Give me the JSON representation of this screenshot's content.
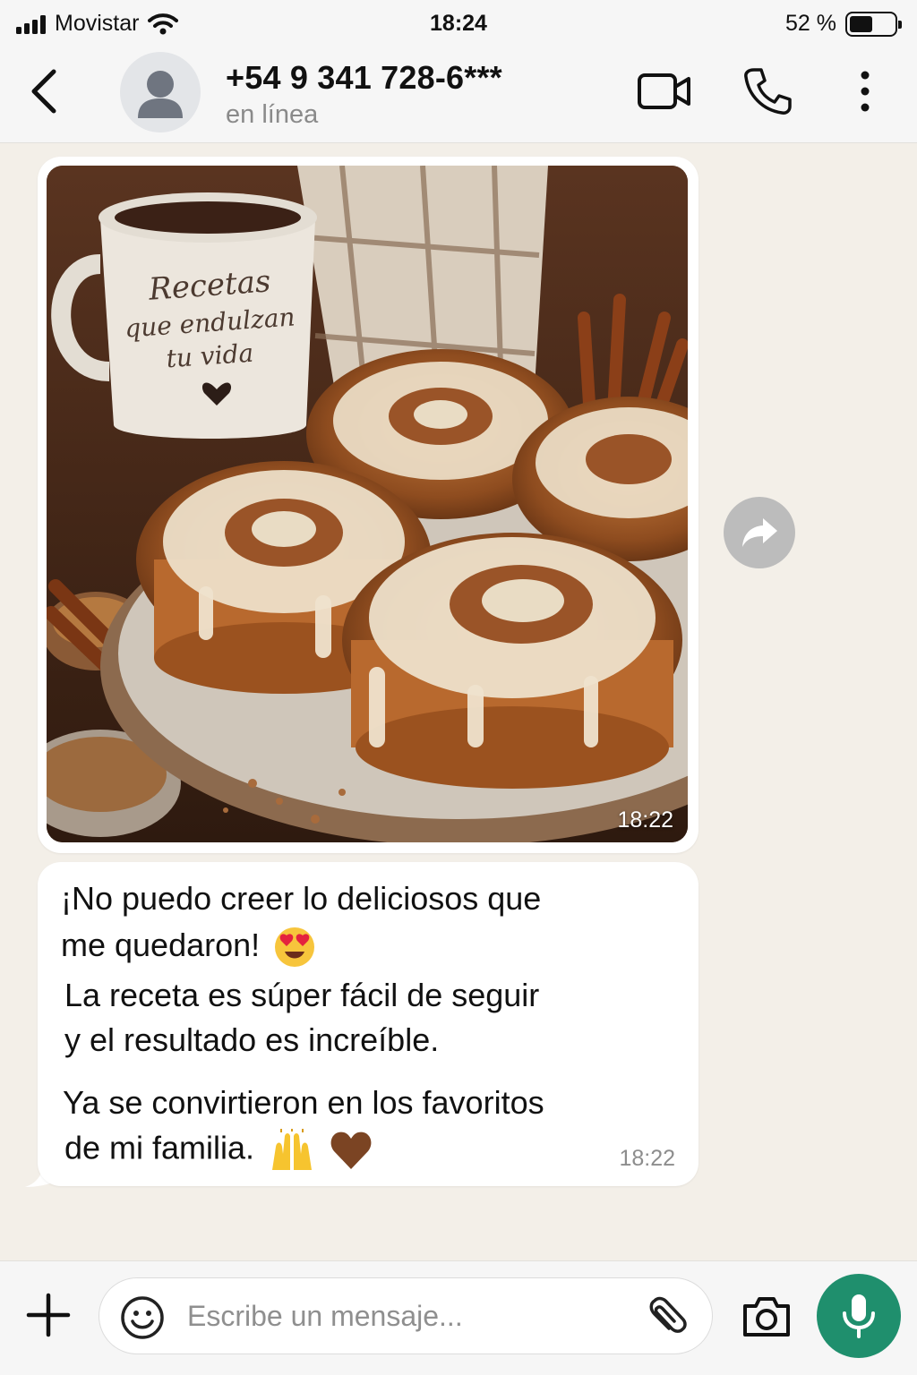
{
  "status_bar": {
    "carrier": "Movistar",
    "time": "18:24",
    "battery_percent_text": "52 %",
    "battery_level": 0.52
  },
  "header": {
    "contact_name": "+54 9 341 728-6***",
    "contact_status": "en línea"
  },
  "messages": {
    "image_message": {
      "time": "18:22",
      "mug_text": [
        "Recetas",
        "que endulzan",
        "tu vida"
      ]
    },
    "text_message": {
      "line1": "¡No puedo creer lo deliciosos que",
      "line2": "me quedaron!",
      "line3": "La receta es súper fácil de seguir",
      "line4": "y el resultado es increíble.",
      "line5": "Ya se convirtieron en los favoritos",
      "line6": "de mi familia.",
      "time": "18:22"
    }
  },
  "input_bar": {
    "placeholder": "Escribe un mensaje..."
  },
  "icons": {
    "back": "chevron-left-icon",
    "video": "video-camera-icon",
    "call": "phone-icon",
    "menu": "more-vertical-icon",
    "forward": "forward-arrow-icon",
    "plus": "plus-icon",
    "emoji": "smiley-icon",
    "attach": "paperclip-icon",
    "camera": "camera-icon",
    "mic": "microphone-icon"
  },
  "colors": {
    "accent": "#1f8f6d",
    "chat_background": "#f3efe8",
    "bubble": "#ffffff"
  }
}
